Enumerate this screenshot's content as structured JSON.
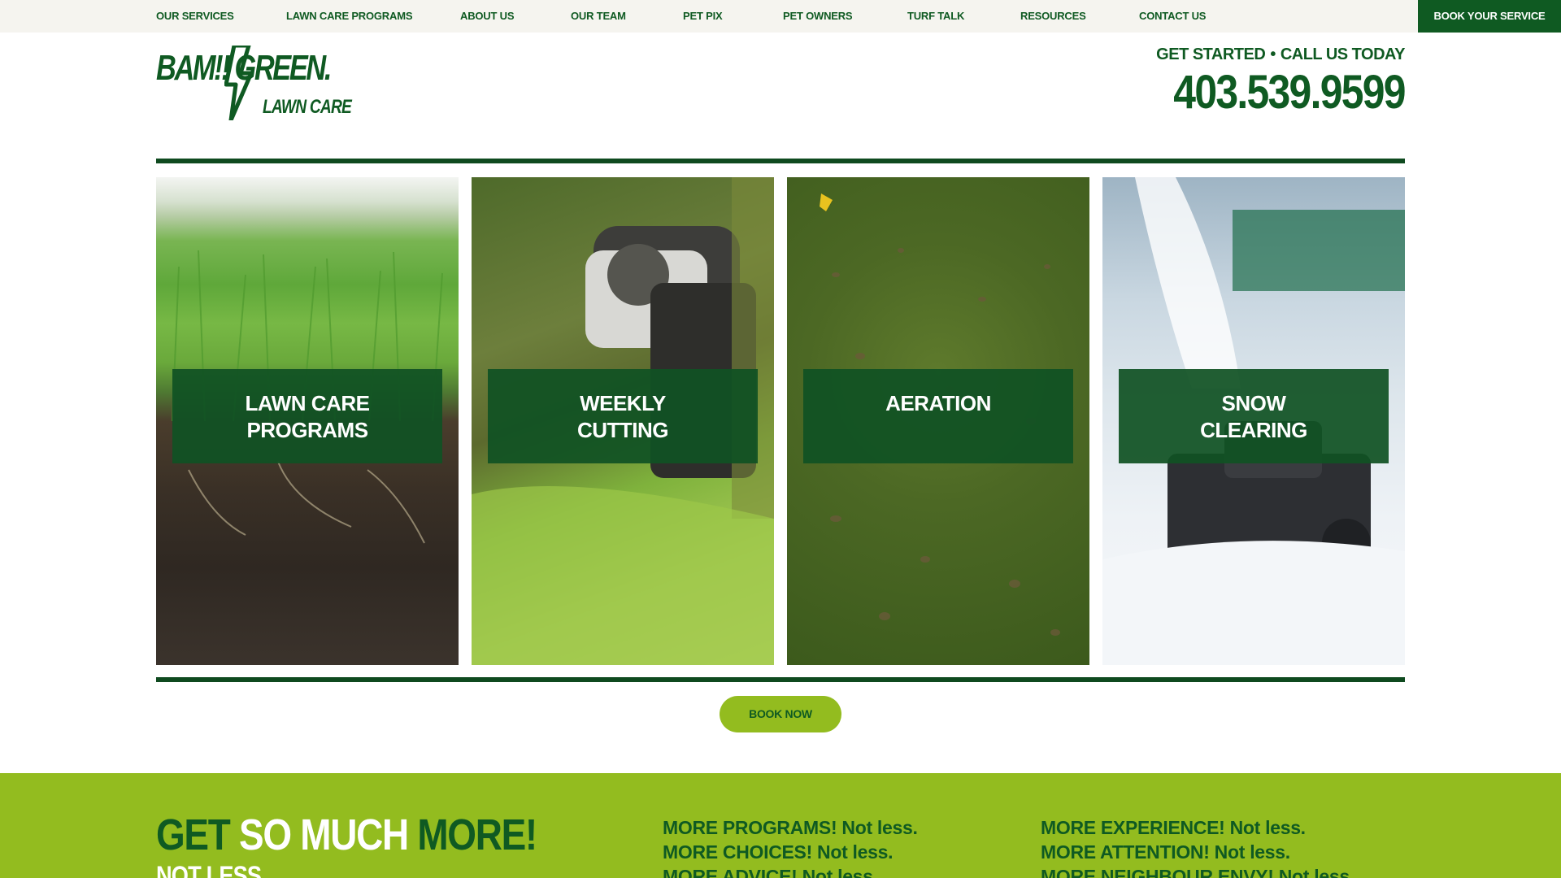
{
  "nav": {
    "items": [
      {
        "label": "OUR SERVICES"
      },
      {
        "label": "LAWN CARE PROGRAMS"
      },
      {
        "label": "ABOUT US"
      },
      {
        "label": "OUR TEAM"
      },
      {
        "label": "PET PIX"
      },
      {
        "label": "PET OWNERS"
      },
      {
        "label": "TURF TALK"
      },
      {
        "label": "RESOURCES"
      },
      {
        "label": "CONTACT US"
      }
    ],
    "cta_label": "BOOK YOUR SERVICE"
  },
  "logo": {
    "line1": "BAM!!  GREEN.",
    "line2": "LAWN CARE"
  },
  "contact": {
    "get_started": "GET STARTED",
    "separator": "•",
    "call_us": "CALL US TODAY",
    "phone": "403.539.9599"
  },
  "tiles": [
    {
      "label": "LAWN CARE\nPROGRAMS"
    },
    {
      "label": "WEEKLY\nCUTTING"
    },
    {
      "label": "AERATION"
    },
    {
      "label": "SNOW\nCLEARING"
    }
  ],
  "book_now_label": "BOOK NOW",
  "band": {
    "headline_part1": "GET ",
    "headline_part2": "SO MUCH ",
    "headline_part3": "MORE!",
    "subhead": "NOT LESS.",
    "col1": [
      {
        "strong": "MORE PROGRAMS!",
        "weak": " Not less."
      },
      {
        "strong": "MORE CHOICES!",
        "weak": " Not less."
      },
      {
        "strong": "MORE ADVICE!",
        "weak": " Not less."
      }
    ],
    "col2": [
      {
        "strong": "MORE EXPERIENCE!",
        "weak": " Not less."
      },
      {
        "strong": "MORE ATTENTION!",
        "weak": " Not less."
      },
      {
        "strong": "MORE NEIGHBOUR ENVY!",
        "weak": " Not less."
      }
    ]
  },
  "colors": {
    "brand_green": "#0f5a22",
    "lime": "#93bc1f",
    "topbar_bg": "#f5f4ef"
  }
}
